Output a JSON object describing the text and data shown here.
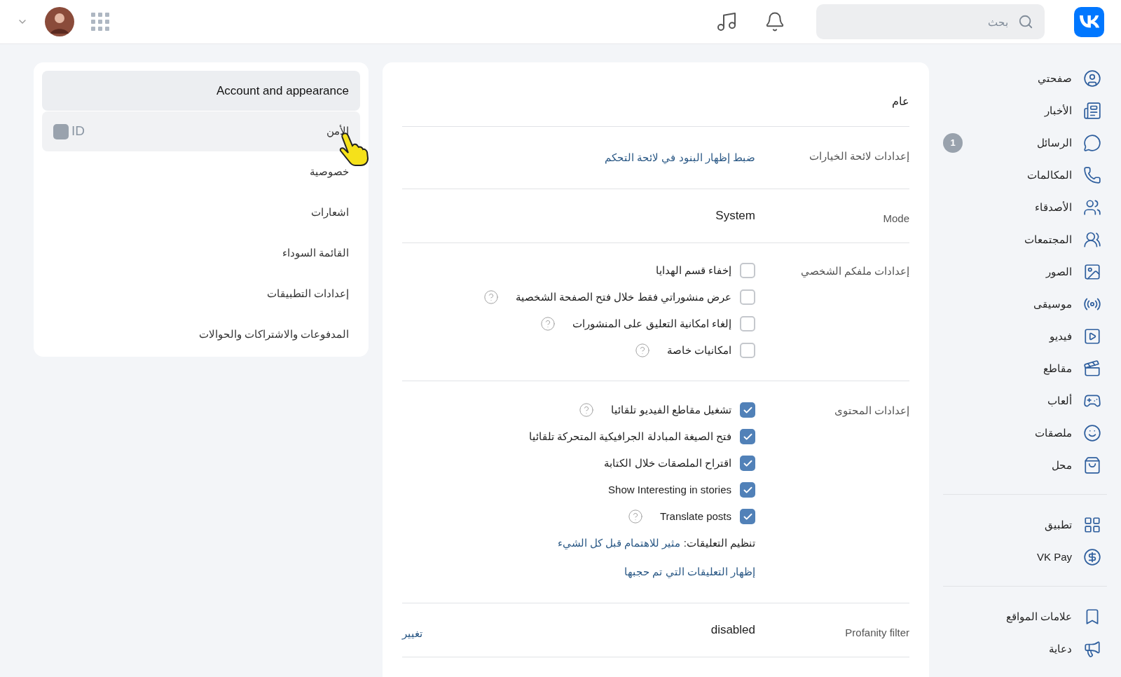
{
  "top_bar": {
    "search": {
      "placeholder": "بحث"
    }
  },
  "sidebar": {
    "groups": [
      {
        "items": [
          {
            "label": "صفحتي"
          },
          {
            "label": "الأخبار"
          },
          {
            "label": "الرسائل",
            "badge": "1"
          },
          {
            "label": "المكالمات"
          },
          {
            "label": "الأصدقاء"
          },
          {
            "label": "المجتمعات"
          },
          {
            "label": "الصور"
          },
          {
            "label": "موسيقى"
          },
          {
            "label": "فيديو"
          },
          {
            "label": "مقاطع"
          },
          {
            "label": "ألعاب"
          },
          {
            "label": "ملصقات"
          },
          {
            "label": "محل"
          }
        ]
      },
      {
        "items": [
          {
            "label": "تطبيق"
          },
          {
            "label": "VK Pay"
          }
        ]
      },
      {
        "items": [
          {
            "label": "علامات المواقع"
          },
          {
            "label": "دعاية"
          }
        ]
      }
    ]
  },
  "settings_menu": {
    "items": [
      {
        "label": "Account and appearance",
        "selected": true
      },
      {
        "label": "الأمن",
        "selected": false,
        "hovered": true,
        "badge": "ID"
      },
      {
        "label": "خصوصية",
        "selected": false
      },
      {
        "label": "اشعارات",
        "selected": false
      },
      {
        "label": "القائمة السوداء",
        "selected": false
      },
      {
        "label": "إعدادات التطبيقات",
        "selected": false
      },
      {
        "label": "المدفوعات والاشتراكات والحوالات",
        "selected": false
      }
    ]
  },
  "general": {
    "title": "عام",
    "sections": [
      {
        "label": "إعدادات لائحة الخيارات",
        "content": [
          {
            "kind": "link",
            "text": "ضبط إظهار البنود في لائحة التحكم"
          }
        ]
      },
      {
        "label": "Mode",
        "content": [
          {
            "kind": "value",
            "text": "System"
          }
        ]
      },
      {
        "label": "إعدادات ملفكم الشخصي",
        "content": [
          {
            "kind": "checkbox",
            "text": "إخفاء قسم الهدايا",
            "checked": false,
            "help": false
          },
          {
            "kind": "checkbox",
            "text": "عرض منشوراتي فقط خلال فتح الصفحة الشخصية",
            "checked": false,
            "help": true
          },
          {
            "kind": "checkbox",
            "text": "إلغاء امكانية التعليق على المنشورات",
            "checked": false,
            "help": true
          },
          {
            "kind": "checkbox",
            "text": "امكانيات خاصة",
            "checked": false,
            "help": true
          }
        ]
      },
      {
        "label": "إعدادات المحتوى",
        "content": [
          {
            "kind": "checkbox",
            "text": "تشغيل مقاطع الفيديو تلقائيا",
            "checked": true,
            "help": true
          },
          {
            "kind": "checkbox",
            "text": "فتح الصيغة المبادلة الجرافيكية المتحركة تلقائيا",
            "checked": true,
            "help": false
          },
          {
            "kind": "checkbox",
            "text": "اقتراح الملصقات خلال الكتابة",
            "checked": true,
            "help": false
          },
          {
            "kind": "checkbox",
            "text": "Show Interesting in stories",
            "checked": true,
            "help": false
          },
          {
            "kind": "checkbox",
            "text": "Translate posts",
            "checked": true,
            "help": true
          },
          {
            "kind": "text_link",
            "text": "تنظيم التعليقات:",
            "link": "مثير للاهتمام قبل كل الشيء"
          },
          {
            "kind": "link",
            "text": "إظهار التعليقات التي تم حجبها"
          }
        ]
      },
      {
        "label": "Profanity filter",
        "content": [
          {
            "kind": "value",
            "text": "disabled"
          }
        ],
        "action": "تغيير"
      }
    ]
  }
}
